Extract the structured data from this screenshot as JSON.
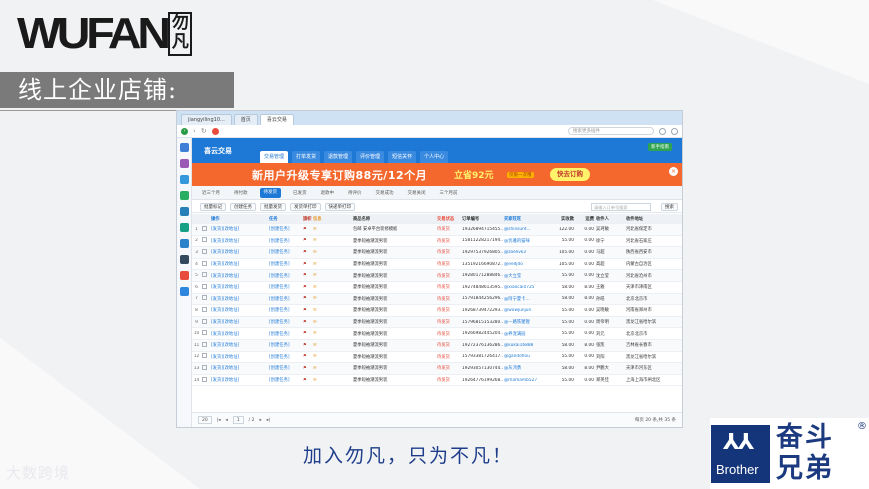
{
  "brand": {
    "logo_word": "WUFAN",
    "logo_seal": "勿凡"
  },
  "section_title": "线上企业店铺:",
  "browser": {
    "tabs": [
      "jiangyiling10...",
      "首页",
      "喜云交易"
    ],
    "active_tab": 2,
    "search_placeholder": "搜索更多插件"
  },
  "app": {
    "logo": "喜云交易",
    "nav": [
      "交易管理",
      "打单发货",
      "退款管理",
      "评价管理",
      "短信关怀",
      "个人中心"
    ],
    "active_nav": 0,
    "new_user_tag": "新手指南",
    "promo": {
      "main": "新用户升级专享订购88元/12个月",
      "save": "立省92元",
      "tag": "仅限一次哦",
      "button": "快去订购",
      "close": "×"
    },
    "subtabs": [
      "近三个月",
      "待付款",
      "待发货",
      "已发货",
      "退款中",
      "待评价",
      "交易成功",
      "交易关闭",
      "三个月前"
    ],
    "active_subtab": 2,
    "toolbar": [
      "批量标记",
      "创建任务",
      "批量发货",
      "发货单打印",
      "快递单打印"
    ],
    "search_placeholder": "请输入订单号搜索",
    "search_button": "搜索",
    "columns": [
      "",
      "",
      "操作",
      "任务",
      "旗帜",
      "信息",
      "商品名称",
      "交易状态",
      "订单编号",
      "买家旺旺",
      "实收款",
      "运费",
      "收件人",
      "收件地址"
    ],
    "rows": [
      {
        "num": "1",
        "op": "[发货][改地址]",
        "task": "[创建任务]",
        "name": "包邮 安卓平台装修模板",
        "status": "待发货",
        "order": "19326894715455...",
        "buyer": "@shinsunt...",
        "paid": "122.00",
        "ship": "0.00",
        "recv": "吴珂敏",
        "addr": "河北省保定市"
      },
      {
        "num": "2",
        "op": "[发货][改地址]",
        "task": "[创建任务]",
        "name": "夏季短袖潮流男装",
        "status": "待发货",
        "order": "15811228217194...",
        "buyer": "@优雅的猫咪",
        "paid": "55.00",
        "ship": "0.00",
        "recv": "徐宁",
        "addr": "河北省石家庄"
      },
      {
        "num": "3",
        "op": "[发货][改地址]",
        "task": "[创建任务]",
        "name": "夏季短袖潮流男装",
        "status": "待发货",
        "order": "19297537926805...",
        "buyer": "@zoelivk3",
        "paid": "105.00",
        "ship": "0.00",
        "recv": "马超",
        "addr": "陕西省西安市"
      },
      {
        "num": "4",
        "op": "[发货][改地址]",
        "task": "[创建任务]",
        "name": "夏季短袖潮流男装",
        "status": "待发货",
        "order": "13519216690872...",
        "buyer": "@eedjdo",
        "paid": "105.00",
        "ship": "0.00",
        "recv": "高超",
        "addr": "内蒙古自治区"
      },
      {
        "num": "5",
        "op": "[发货][改地址]",
        "task": "[创建任务]",
        "name": "夏季短袖潮流男装",
        "status": "待发货",
        "order": "19280171288846...",
        "buyer": "@大立莹",
        "paid": "55.00",
        "ship": "0.00",
        "recv": "沈立莹",
        "addr": "河北省沧州市"
      },
      {
        "num": "6",
        "op": "[发货][改地址]",
        "task": "[创建任务]",
        "name": "夏季短袖潮流男装",
        "status": "待发货",
        "order": "19274848613595...",
        "buyer": "@xiaocai0725",
        "paid": "58.00",
        "ship": "8.00",
        "recv": "王雅",
        "addr": "天津市津南区"
      },
      {
        "num": "7",
        "op": "[发货][改地址]",
        "task": "[创建任务]",
        "name": "夏季短袖潮流男装",
        "status": "待发货",
        "order": "15791844256296...",
        "buyer": "@阿宁夏卡...",
        "paid": "58.00",
        "ship": "8.00",
        "recv": "孙皓",
        "addr": "北京北京市"
      },
      {
        "num": "8",
        "op": "[发货][改地址]",
        "task": "[创建任务]",
        "name": "夏季短袖潮流男装",
        "status": "待发货",
        "order": "19268739472293...",
        "buyer": "@wowjunjun",
        "paid": "55.00",
        "ship": "0.00",
        "recv": "吴晓敏",
        "addr": "河南省郑州市"
      },
      {
        "num": "9",
        "op": "[发货][改地址]",
        "task": "[创建任务]",
        "name": "夏季短袖潮流男装",
        "status": "待发货",
        "order": "15796815153280...",
        "buyer": "@一路铁猩猩",
        "paid": "55.00",
        "ship": "0.00",
        "recv": "周帝明",
        "addr": "黑龙江省哈尔滨"
      },
      {
        "num": "10",
        "op": "[发货][改地址]",
        "task": "[创建任务]",
        "name": "夏季短袖潮流男装",
        "status": "待发货",
        "order": "19266982445204...",
        "buyer": "@养宠满园",
        "paid": "55.00",
        "ship": "0.00",
        "recv": "刘元",
        "addr": "北京北京市"
      },
      {
        "num": "11",
        "op": "[发货][改地址]",
        "task": "[创建任务]",
        "name": "夏季短袖潮流男装",
        "status": "待发货",
        "order": "19272376136286...",
        "buyer": "@kukai16888",
        "paid": "58.00",
        "ship": "8.00",
        "recv": "张凯",
        "addr": "吉林省长春市"
      },
      {
        "num": "12",
        "op": "[发货][改地址]",
        "task": "[创建任务]",
        "name": "夏季短袖潮流男装",
        "status": "待发货",
        "order": "15793381726417...",
        "buyer": "@gandoflou",
        "paid": "55.00",
        "ship": "0.00",
        "recv": "刘阳",
        "addr": "黑龙江省哈尔滨"
      },
      {
        "num": "13",
        "op": "[发货][改地址]",
        "task": "[创建任务]",
        "name": "夏季短袖潮流男装",
        "status": "待发货",
        "order": "19293057130744...",
        "buyer": "@灰鸿勇",
        "paid": "58.00",
        "ship": "8.00",
        "recv": "尹鹏大",
        "addr": "天津市河东区"
      },
      {
        "num": "14",
        "op": "[发货][改地址]",
        "task": "[创建任务]",
        "name": "夏季短袖潮流男装",
        "status": "待发货",
        "order": "19264776199268...",
        "buyer": "@mamamb527",
        "paid": "55.00",
        "ship": "0.00",
        "recv": "郑英佳",
        "addr": "上海上海市闸北区"
      }
    ],
    "footer": {
      "page_size": "20",
      "page": "1",
      "page_total": "/ 2",
      "info": "每页 20 条,共 35 条"
    }
  },
  "slogan": "加入勿凡，只为不凡！",
  "watermark": "大数跨境",
  "brother": {
    "mark": "⅄⅄",
    "name": "Brother",
    "cn": "奋斗兄弟",
    "reg": "®",
    "color": "#15357a"
  }
}
